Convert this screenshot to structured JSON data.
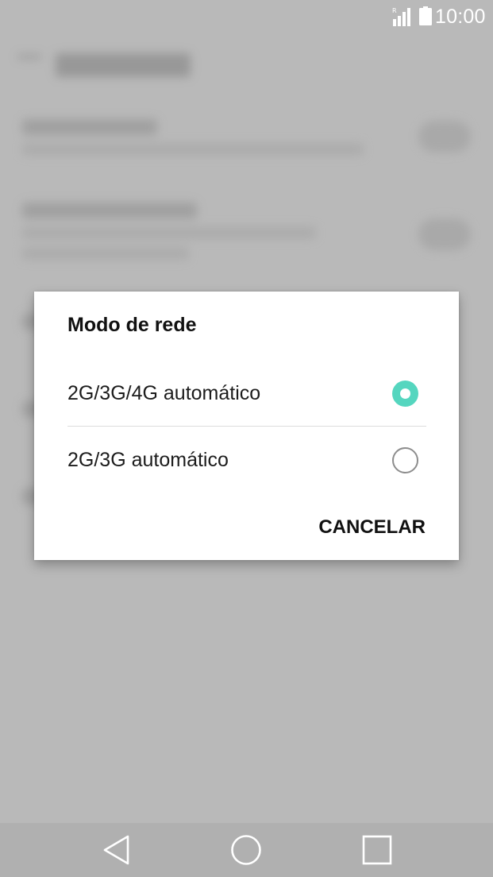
{
  "status_bar": {
    "time": "10:00",
    "roaming_indicator": "R",
    "icons": [
      "signal-icon",
      "battery-icon"
    ]
  },
  "dialog": {
    "title": "Modo de rede",
    "options": [
      {
        "label": "2G/3G/4G automático",
        "selected": true
      },
      {
        "label": "2G/3G automático",
        "selected": false
      }
    ],
    "cancel_label": "CANCELAR",
    "accent_color": "#55d6bf"
  },
  "nav_bar": {
    "icons": [
      "back-icon",
      "home-icon",
      "recents-icon"
    ]
  }
}
